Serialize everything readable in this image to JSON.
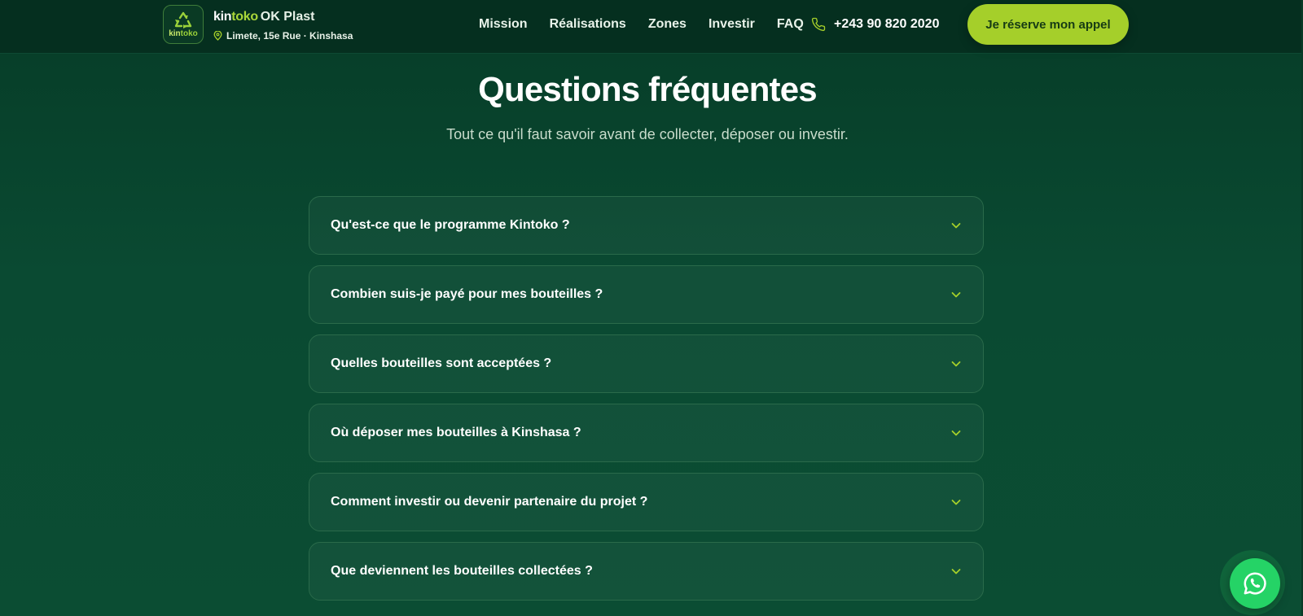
{
  "header": {
    "logo_mini": {
      "part1": "kin",
      "part2": "toko"
    },
    "brand": {
      "kin": "kin",
      "toko": "toko",
      "rest": "OK Plast"
    },
    "address": "Limete, 15e Rue · Kinshasa",
    "nav": [
      "Mission",
      "Réalisations",
      "Zones",
      "Investir",
      "FAQ"
    ],
    "phone": "+243 90 820 2020",
    "cta_label": "Je réserve mon appel"
  },
  "main": {
    "title": "Questions fréquentes",
    "subtitle": "Tout ce qu'il faut savoir avant de collecter, déposer ou investir.",
    "faq": [
      "Qu'est-ce que le programme Kintoko ?",
      "Combien suis-je payé pour mes bouteilles ?",
      "Quelles bouteilles sont acceptées ?",
      "Où déposer mes bouteilles à Kinshasa ?",
      "Comment investir ou devenir partenaire du projet ?",
      "Que deviennent les bouteilles collectées ?"
    ]
  },
  "colors": {
    "background": "#0a4a32",
    "header": "#052f1f",
    "accent": "#a5cf2a",
    "whatsapp": "#25d366"
  },
  "icons": {
    "logo": "recycle-icon",
    "address": "location-pin-icon",
    "phone": "phone-icon",
    "faq_toggle": "chevron-down-icon",
    "whatsapp": "whatsapp-icon"
  }
}
